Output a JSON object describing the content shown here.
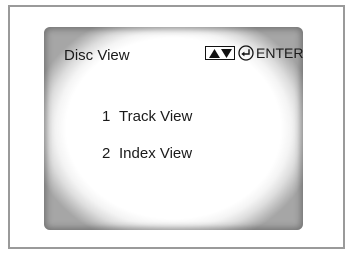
{
  "screen": {
    "title": "Disc View",
    "hint": {
      "icons": [
        "up-arrow-icon",
        "down-arrow-icon",
        "enter-icon"
      ],
      "label": "ENTER"
    },
    "menu": [
      {
        "number": "1",
        "label": "Track View"
      },
      {
        "number": "2",
        "label": "Index View"
      }
    ]
  },
  "colors": {
    "text": "#1a1a1a",
    "frame_border": "#9a9a9a",
    "screen_vignette": "#a6a6a6"
  }
}
